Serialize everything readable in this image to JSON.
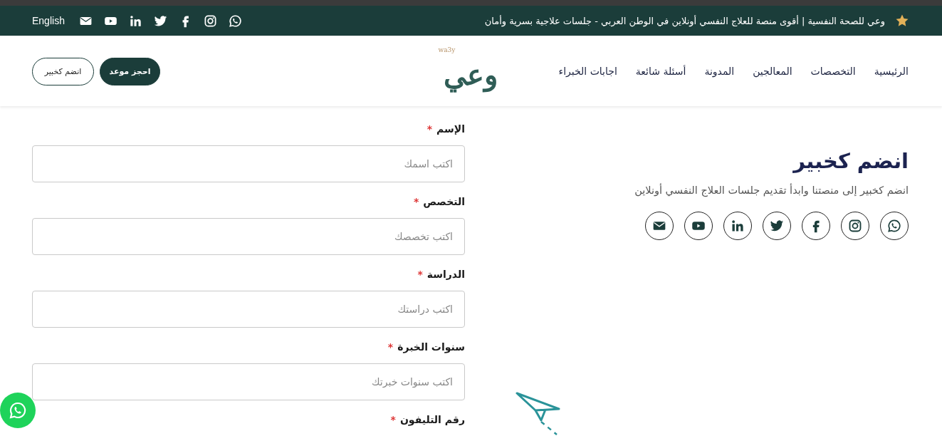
{
  "top_bar": {
    "tagline": "وعي للصحة النفسية | أقوى منصة للعلاج النفسي أونلاين في الوطن العربي - جلسات علاجية بسرية وأمان",
    "language_link": "English"
  },
  "header": {
    "nav": [
      "الرئيسية",
      "التخصصات",
      "المعالجين",
      "المدونة",
      "أسئلة شائعة",
      "اجابات الخبراء"
    ],
    "logo": {
      "latin": "wa3y",
      "arabic": "وعي"
    },
    "buttons": [
      {
        "label": "احجز موعد",
        "kind": "filled"
      },
      {
        "label": "انضم كخبير",
        "kind": "outline"
      }
    ]
  },
  "intro": {
    "title": "انضم كخبير",
    "subtitle": "انضم كخبير إلى منصتنا وابدأ تقديم جلسات العلاج النفسي أونلاين"
  },
  "form": {
    "fields": [
      {
        "label": "الإسم",
        "required_mark": "*",
        "placeholder": "اكتب اسمك"
      },
      {
        "label": "التخصص",
        "required_mark": "*",
        "placeholder": "اكتب تخصصك"
      },
      {
        "label": "الدراسة",
        "required_mark": "*",
        "placeholder": "اكتب دراستك"
      },
      {
        "label": "سنوات الخبرة",
        "required_mark": "*",
        "placeholder": "اكتب سنوات خبرتك"
      },
      {
        "label": "رقم التليفون",
        "required_mark": "*"
      }
    ]
  }
}
